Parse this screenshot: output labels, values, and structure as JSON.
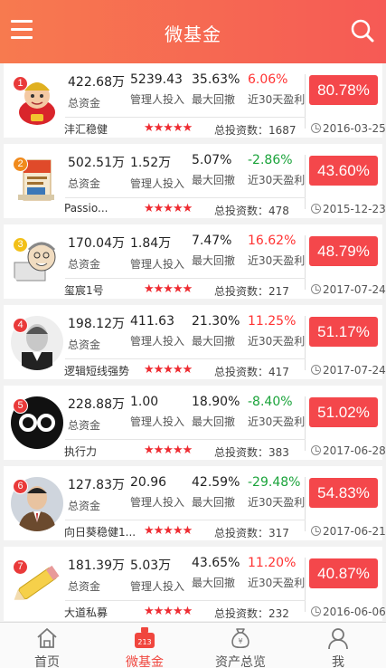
{
  "header": {
    "title": "微基金"
  },
  "labels": {
    "total_assets": "总资金",
    "manager_invest": "管理人投入",
    "max_drawdown": "最大回撤",
    "profit_30d": "近30天盈利",
    "investors_prefix": "总投资数："
  },
  "funds": [
    {
      "rank": "1",
      "rank_color": "#e93a3a",
      "total": "422.68万",
      "manager": "5239.43",
      "drawdown": "35.63%",
      "profit": "6.06%",
      "profit_sign": "up",
      "rate": "80.78%",
      "name": "沣汇稳健",
      "stars": "★★★★★",
      "investors": "1687",
      "date": "2016-03-25"
    },
    {
      "rank": "2",
      "rank_color": "#f08a1c",
      "total": "502.51万",
      "manager": "1.52万",
      "drawdown": "5.07%",
      "profit": "-2.86%",
      "profit_sign": "down",
      "rate": "43.60%",
      "name": "Passio...",
      "stars": "★★★★★",
      "investors": "478",
      "date": "2015-12-23"
    },
    {
      "rank": "3",
      "rank_color": "#f2c018",
      "total": "170.04万",
      "manager": "1.84万",
      "drawdown": "7.47%",
      "profit": "16.62%",
      "profit_sign": "up",
      "rate": "48.79%",
      "name": "玺宸1号",
      "stars": "★★★★★",
      "investors": "217",
      "date": "2017-07-24"
    },
    {
      "rank": "4",
      "rank_color": "#e93a3a",
      "total": "198.12万",
      "manager": "411.63",
      "drawdown": "21.30%",
      "profit": "11.25%",
      "profit_sign": "up",
      "rate": "51.17%",
      "name": "逻辑短线强势",
      "stars": "★★★★★",
      "investors": "417",
      "date": "2017-07-24"
    },
    {
      "rank": "5",
      "rank_color": "#e93a3a",
      "total": "228.88万",
      "manager": "1.00",
      "drawdown": "18.90%",
      "profit": "-8.40%",
      "profit_sign": "down",
      "rate": "51.02%",
      "name": "执行力",
      "stars": "★★★★★",
      "investors": "383",
      "date": "2017-06-28"
    },
    {
      "rank": "6",
      "rank_color": "#e93a3a",
      "total": "127.83万",
      "manager": "20.96",
      "drawdown": "42.59%",
      "profit": "-29.48%",
      "profit_sign": "down",
      "rate": "54.83%",
      "name": "向日葵稳健1...",
      "stars": "★★★★★",
      "investors": "317",
      "date": "2017-06-21"
    },
    {
      "rank": "7",
      "rank_color": "#e93a3a",
      "total": "181.39万",
      "manager": "5.03万",
      "drawdown": "43.65%",
      "profit": "11.20%",
      "profit_sign": "up",
      "rate": "40.87%",
      "name": "大道私募",
      "stars": "★★★★★",
      "investors": "232",
      "date": "2016-06-06"
    }
  ],
  "tabs": [
    {
      "label": "首页",
      "icon": "home-icon",
      "active": false
    },
    {
      "label": "微基金",
      "icon": "fund-icon",
      "active": true
    },
    {
      "label": "资产总览",
      "icon": "money-bag-icon",
      "active": false
    },
    {
      "label": "我",
      "icon": "person-icon",
      "active": false
    }
  ],
  "colors": {
    "accent": "#f4474b",
    "up": "#ff3333",
    "down": "#1aa33a"
  }
}
